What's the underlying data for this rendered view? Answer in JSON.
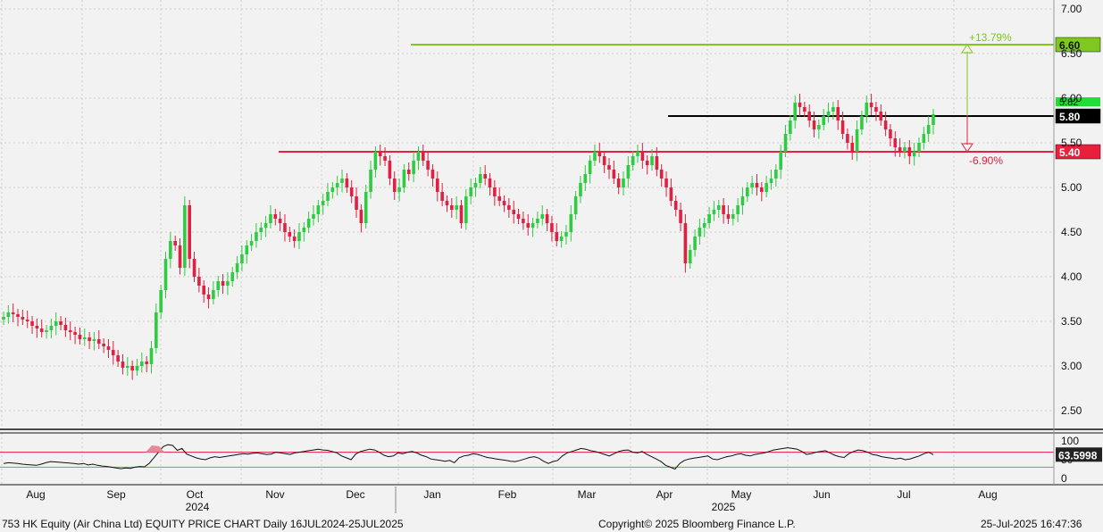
{
  "chart_data": {
    "type": "candlestick",
    "title": "753 HK Equity (Air China Ltd) EQUITY PRICE CHART",
    "frequency": "Daily",
    "date_range": "16JUL2024-25JUL2025",
    "price_axis": {
      "min": 2.3,
      "max": 7.1,
      "ticks": [
        "7.00",
        "6.50",
        "6.00",
        "5.50",
        "5.00",
        "4.50",
        "4.00",
        "3.50",
        "3.00",
        "2.50"
      ],
      "tick_values": [
        7.0,
        6.5,
        6.0,
        5.5,
        5.0,
        4.5,
        4.0,
        3.5,
        3.0,
        2.5
      ]
    },
    "x_axis": {
      "months": [
        "Aug",
        "Sep",
        "Oct",
        "Nov",
        "Dec",
        "Jan",
        "Feb",
        "Mar",
        "Apr",
        "May",
        "Jun",
        "Jul",
        "Aug"
      ],
      "years": [
        "2024",
        "2025"
      ]
    },
    "horizontal_lines": [
      {
        "name": "target",
        "value": 6.6,
        "label": "6.60",
        "color": "#7ec820"
      },
      {
        "name": "current",
        "value": 5.8,
        "label": "5.80",
        "color": "#000000"
      },
      {
        "name": "support",
        "value": 5.4,
        "label": "5.40",
        "color": "#e8203c"
      }
    ],
    "annotations": {
      "up_pct": "+13.79%",
      "down_pct": "-6.90%"
    },
    "last_price_label": "5.82",
    "closes": [
      3.55,
      3.6,
      3.58,
      3.55,
      3.52,
      3.5,
      3.45,
      3.42,
      3.38,
      3.4,
      3.45,
      3.5,
      3.46,
      3.4,
      3.38,
      3.35,
      3.3,
      3.32,
      3.28,
      3.3,
      3.25,
      3.22,
      3.18,
      3.12,
      3.05,
      2.98,
      3.0,
      2.95,
      3.0,
      3.05,
      3.02,
      3.2,
      3.6,
      3.85,
      4.2,
      4.4,
      4.35,
      4.1,
      4.8,
      4.2,
      4.0,
      3.9,
      3.8,
      3.75,
      3.85,
      3.95,
      3.9,
      3.95,
      4.05,
      4.15,
      4.25,
      4.35,
      4.4,
      4.5,
      4.55,
      4.6,
      4.7,
      4.65,
      4.6,
      4.5,
      4.45,
      4.4,
      4.5,
      4.55,
      4.65,
      4.7,
      4.8,
      4.85,
      4.95,
      5.0,
      5.05,
      5.1,
      5.0,
      4.9,
      4.75,
      4.6,
      4.95,
      5.2,
      5.4,
      5.35,
      5.3,
      5.1,
      4.95,
      5.0,
      5.2,
      5.15,
      5.3,
      5.4,
      5.3,
      5.2,
      5.1,
      4.95,
      4.85,
      4.8,
      4.75,
      4.8,
      4.6,
      4.9,
      5.0,
      5.05,
      5.15,
      5.1,
      5.0,
      4.9,
      4.85,
      4.8,
      4.75,
      4.7,
      4.65,
      4.6,
      4.55,
      4.6,
      4.65,
      4.7,
      4.6,
      4.5,
      4.4,
      4.45,
      4.5,
      4.7,
      4.9,
      5.05,
      5.15,
      5.3,
      5.4,
      5.35,
      5.25,
      5.2,
      5.1,
      5.0,
      5.1,
      5.25,
      5.35,
      5.4,
      5.3,
      5.25,
      5.35,
      5.2,
      5.1,
      5.0,
      4.85,
      4.75,
      4.6,
      4.15,
      4.3,
      4.45,
      4.55,
      4.6,
      4.7,
      4.75,
      4.8,
      4.7,
      4.65,
      4.7,
      4.8,
      4.9,
      5.0,
      5.05,
      5.0,
      4.95,
      5.05,
      5.1,
      5.2,
      5.4,
      5.6,
      5.75,
      5.95,
      5.9,
      5.85,
      5.75,
      5.65,
      5.7,
      5.8,
      5.85,
      5.9,
      5.75,
      5.6,
      5.5,
      5.4,
      5.65,
      5.8,
      5.95,
      5.9,
      5.85,
      5.75,
      5.65,
      5.55,
      5.45,
      5.4,
      5.45,
      5.35,
      5.4,
      5.5,
      5.6,
      5.7,
      5.82
    ]
  },
  "rsi": {
    "axis_ticks": [
      "100",
      "50",
      "0"
    ],
    "overbought": 70,
    "oversold": 30,
    "last_value_label": "63.5998",
    "values": [
      40,
      42,
      41,
      40,
      38,
      37,
      36,
      35,
      38,
      42,
      45,
      44,
      43,
      42,
      41,
      40,
      38,
      40,
      36,
      38,
      35,
      33,
      32,
      30,
      28,
      26,
      28,
      27,
      30,
      32,
      31,
      40,
      55,
      70,
      85,
      90,
      88,
      75,
      80,
      65,
      60,
      55,
      52,
      50,
      55,
      58,
      56,
      58,
      60,
      62,
      64,
      66,
      65,
      67,
      68,
      66,
      64,
      65,
      70,
      68,
      66,
      64,
      68,
      70,
      72,
      74,
      76,
      78,
      76,
      75,
      72,
      68,
      60,
      55,
      50,
      65,
      72,
      75,
      78,
      76,
      70,
      62,
      58,
      60,
      68,
      66,
      70,
      72,
      68,
      62,
      58,
      52,
      50,
      48,
      46,
      48,
      42,
      55,
      60,
      62,
      66,
      64,
      60,
      56,
      54,
      52,
      50,
      48,
      46,
      45,
      48,
      52,
      56,
      58,
      54,
      46,
      40,
      45,
      48,
      60,
      68,
      72,
      76,
      80,
      78,
      74,
      72,
      68,
      64,
      60,
      66,
      72,
      75,
      76,
      70,
      68,
      72,
      64,
      58,
      52,
      45,
      35,
      30,
      25,
      40,
      48,
      52,
      54,
      56,
      58,
      60,
      52,
      50,
      54,
      58,
      60,
      64,
      66,
      62,
      60,
      64,
      66,
      68,
      72,
      76,
      78,
      80,
      82,
      80,
      78,
      72,
      64,
      66,
      70,
      72,
      74,
      68,
      62,
      58,
      56,
      66,
      72,
      76,
      74,
      70,
      64,
      62,
      58,
      56,
      54,
      52,
      54,
      50,
      52,
      56,
      60,
      66,
      70,
      63.6
    ]
  },
  "footer": {
    "left": "753 HK Equity (Air China Ltd) EQUITY PRICE CHART  Daily 16JUL2024-25JUL2025",
    "center": "Copyright© 2025 Bloomberg Finance L.P.",
    "right": "25-Jul-2025 16:47:36"
  },
  "colors": {
    "up": "#2ecc40",
    "down": "#e02040",
    "background": "#f2f2f2",
    "grid": "#cfcfcf"
  }
}
